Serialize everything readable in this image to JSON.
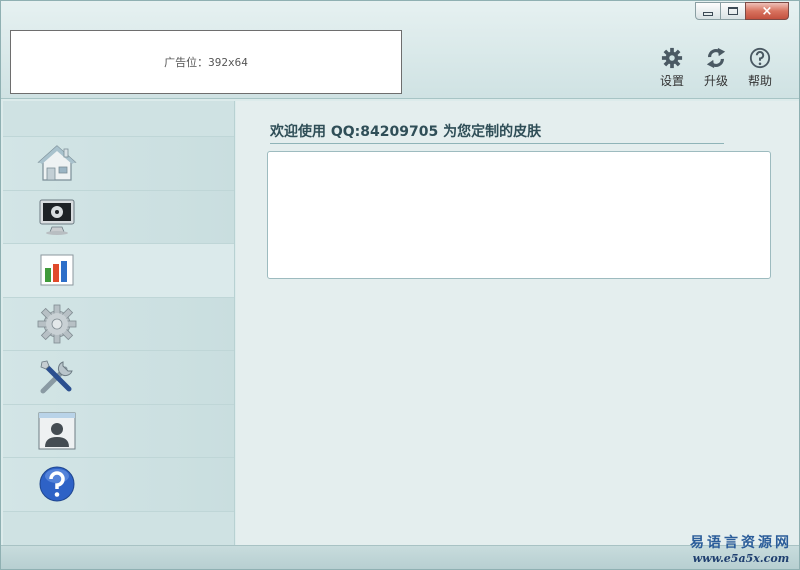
{
  "window": {
    "controls": {
      "minimize": "minimize",
      "maximize": "maximize",
      "close": "×"
    }
  },
  "header": {
    "ad_text": "广告位：392x64",
    "tools": [
      {
        "id": "settings",
        "label": "设置",
        "icon": "gear-icon"
      },
      {
        "id": "upgrade",
        "label": "升级",
        "icon": "refresh-icon"
      },
      {
        "id": "help",
        "label": "帮助",
        "icon": "help-icon"
      }
    ]
  },
  "sidebar": {
    "items": [
      {
        "id": "home",
        "icon": "home-icon",
        "active": false
      },
      {
        "id": "monitor",
        "icon": "monitor-icon",
        "active": false
      },
      {
        "id": "chart",
        "icon": "chart-icon",
        "active": true
      },
      {
        "id": "settings",
        "icon": "gear-icon",
        "active": false
      },
      {
        "id": "tools",
        "icon": "tools-icon",
        "active": false
      },
      {
        "id": "user",
        "icon": "user-icon",
        "active": false
      },
      {
        "id": "help",
        "icon": "help-icon",
        "active": false
      }
    ]
  },
  "main": {
    "welcome_text": "欢迎使用 QQ:84209705 为您定制的皮肤",
    "content_text": ""
  },
  "watermark": {
    "text": "易语言资源网",
    "url": "www.e5a5x.com"
  },
  "colors": {
    "accent": "#2f4e57",
    "background": "#dcebeb",
    "close_button": "#d8735f"
  }
}
